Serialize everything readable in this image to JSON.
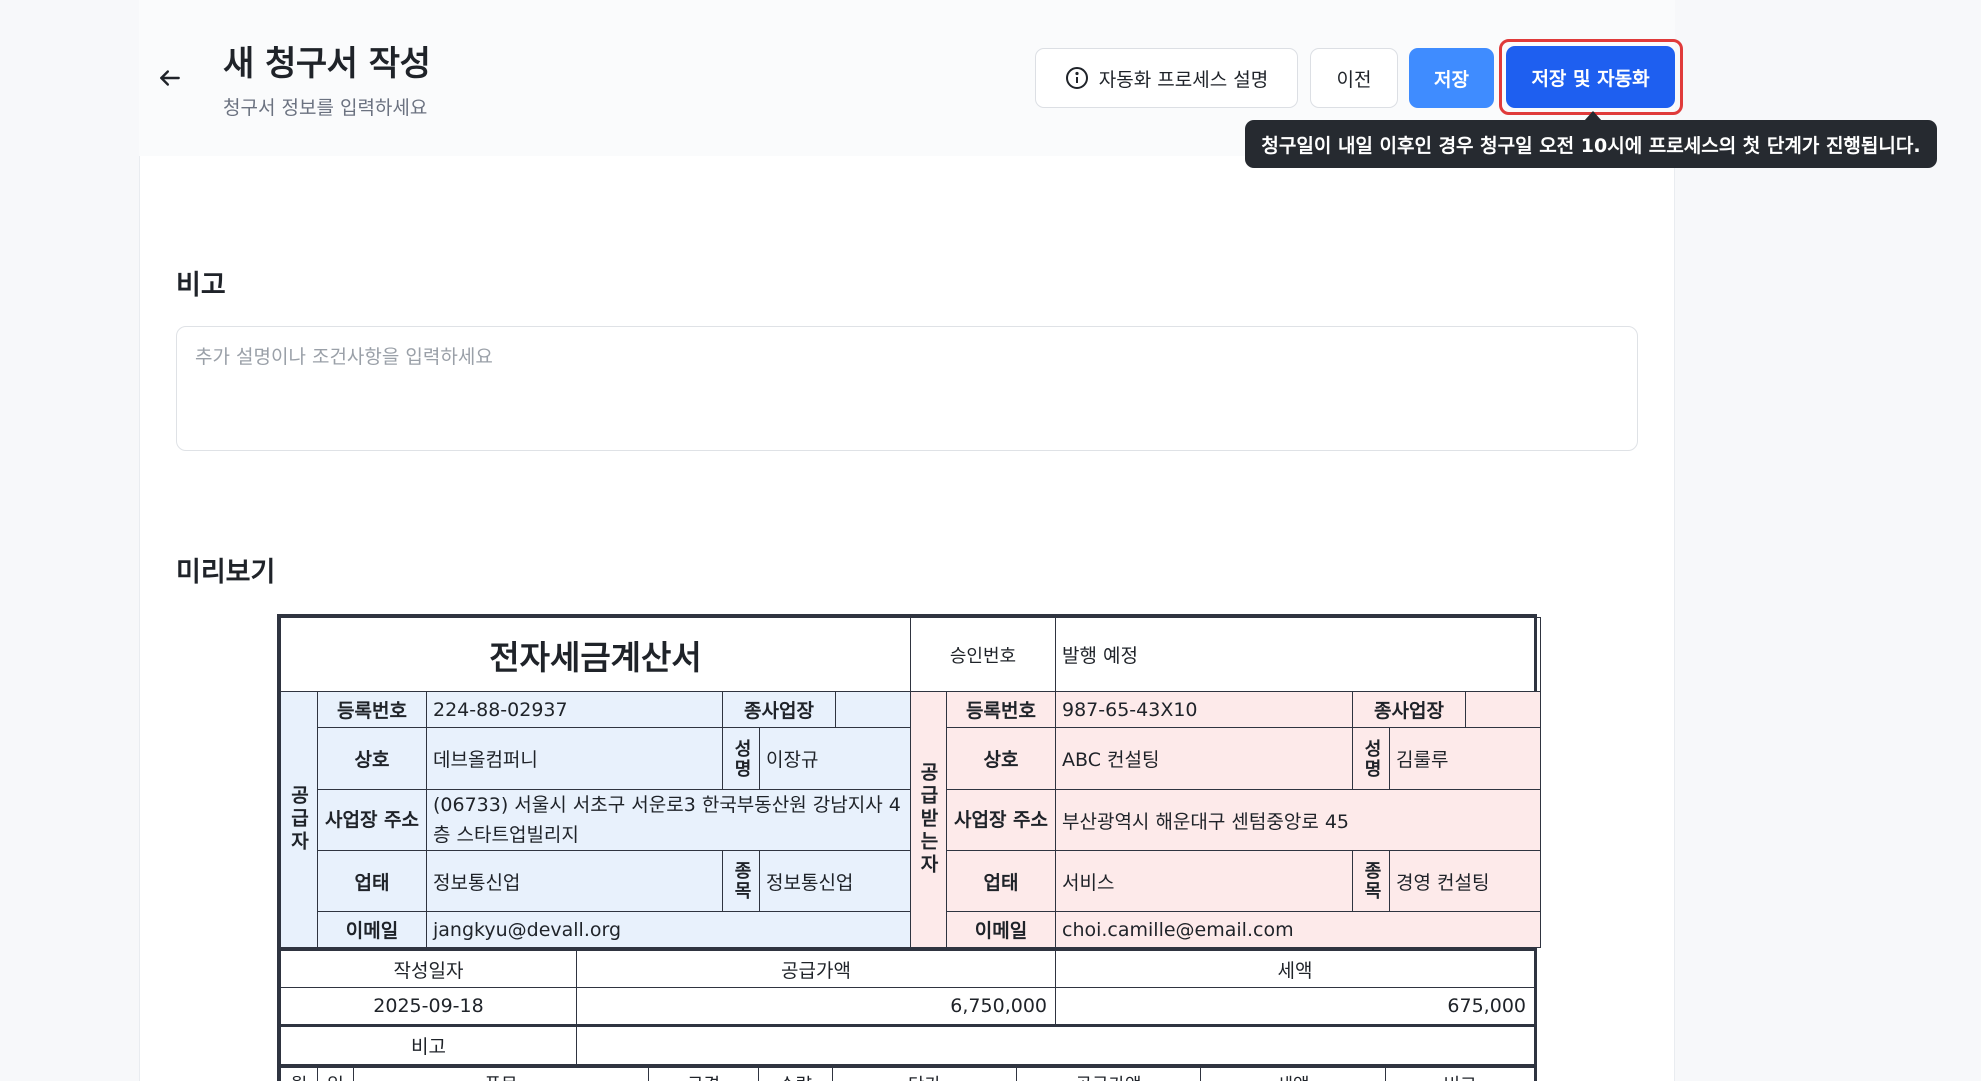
{
  "header": {
    "title": "새 청구서 작성",
    "subtitle": "청구서 정보를 입력하세요",
    "help_button": "자동화 프로세스 설명",
    "prev_button": "이전",
    "save_button": "저장",
    "save_auto_button": "저장 및 자동화",
    "tooltip": "청구일이 내일 이후인 경우 청구일 오전 10시에 프로세스의 첫 단계가 진행됩니다."
  },
  "note": {
    "title": "비고",
    "placeholder": "추가 설명이나 조건사항을 입력하세요",
    "value": ""
  },
  "preview": {
    "title": "미리보기"
  },
  "invoice": {
    "title": "전자세금계산서",
    "approval_label": "승인번호",
    "approval_value": "발행 예정",
    "supplier": {
      "side_label": "공급자",
      "reg_label": "등록번호",
      "reg_value": "224-88-02937",
      "branch_label": "종사업장",
      "branch_value": "",
      "name_label": "상호",
      "name_value": "데브올컴퍼니",
      "ceo_label": "성명",
      "ceo_value": "이장규",
      "addr_label": "사업장 주소",
      "addr_value": "(06733) 서울시 서초구 서운로3 한국부동산원 강남지사 4층 스타트업빌리지",
      "biz_label": "업태",
      "biz_value": "정보통신업",
      "item_label": "종목",
      "item_value": "정보통신업",
      "email_label": "이메일",
      "email_value": "jangkyu@devall.org"
    },
    "receiver": {
      "side_label": "공급받는자",
      "reg_label": "등록번호",
      "reg_value": "987-65-43X10",
      "branch_label": "종사업장",
      "branch_value": "",
      "name_label": "상호",
      "name_value": "ABC 컨설팅",
      "ceo_label": "성명",
      "ceo_value": "김룰루",
      "addr_label": "사업장 주소",
      "addr_value": "부산광역시 해운대구 센텀중앙로 45",
      "biz_label": "업태",
      "biz_value": "서비스",
      "item_label": "종목",
      "item_value": "경영 컨설팅",
      "email_label": "이메일",
      "email_value": "choi.camille@email.com"
    },
    "summary": {
      "date_label": "작성일자",
      "supply_label": "공급가액",
      "tax_label": "세액",
      "date_value": "2025-09-18",
      "supply_value": "6,750,000",
      "tax_value": "675,000",
      "note_label": "비고",
      "note_value": ""
    },
    "items_header": [
      "월",
      "일",
      "품목",
      "규격",
      "수량",
      "단가",
      "공급가액",
      "세액",
      "비고"
    ]
  }
}
